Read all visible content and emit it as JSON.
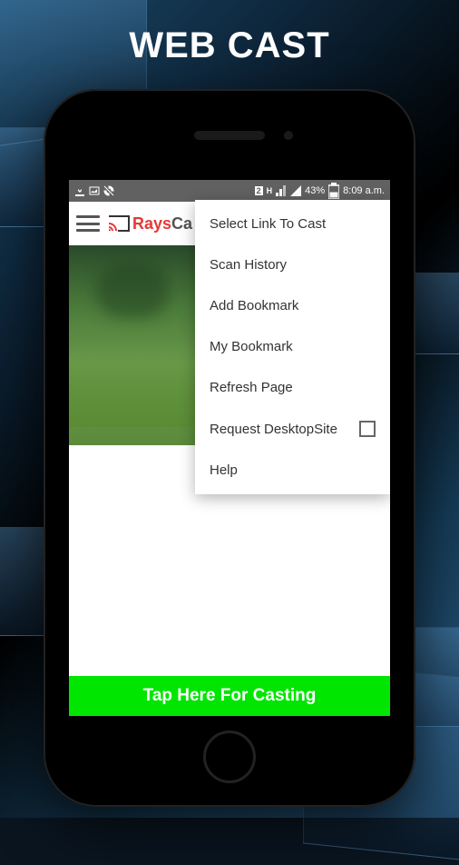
{
  "page_title": "WEB CAST",
  "statusbar": {
    "indicator_2": "2",
    "indicator_h": "H",
    "battery_text": "43%",
    "time": "8:09 a.m."
  },
  "appbar": {
    "brand_red": "Rays",
    "brand_gray": "Ca"
  },
  "menu": {
    "items": [
      {
        "label": "Select Link To Cast"
      },
      {
        "label": "Scan History"
      },
      {
        "label": "Add Bookmark"
      },
      {
        "label": "My Bookmark"
      },
      {
        "label": "Refresh Page"
      },
      {
        "label": "Request DesktopSite",
        "checkbox": true
      },
      {
        "label": "Help"
      }
    ]
  },
  "cast_button": "Tap Here For Casting"
}
